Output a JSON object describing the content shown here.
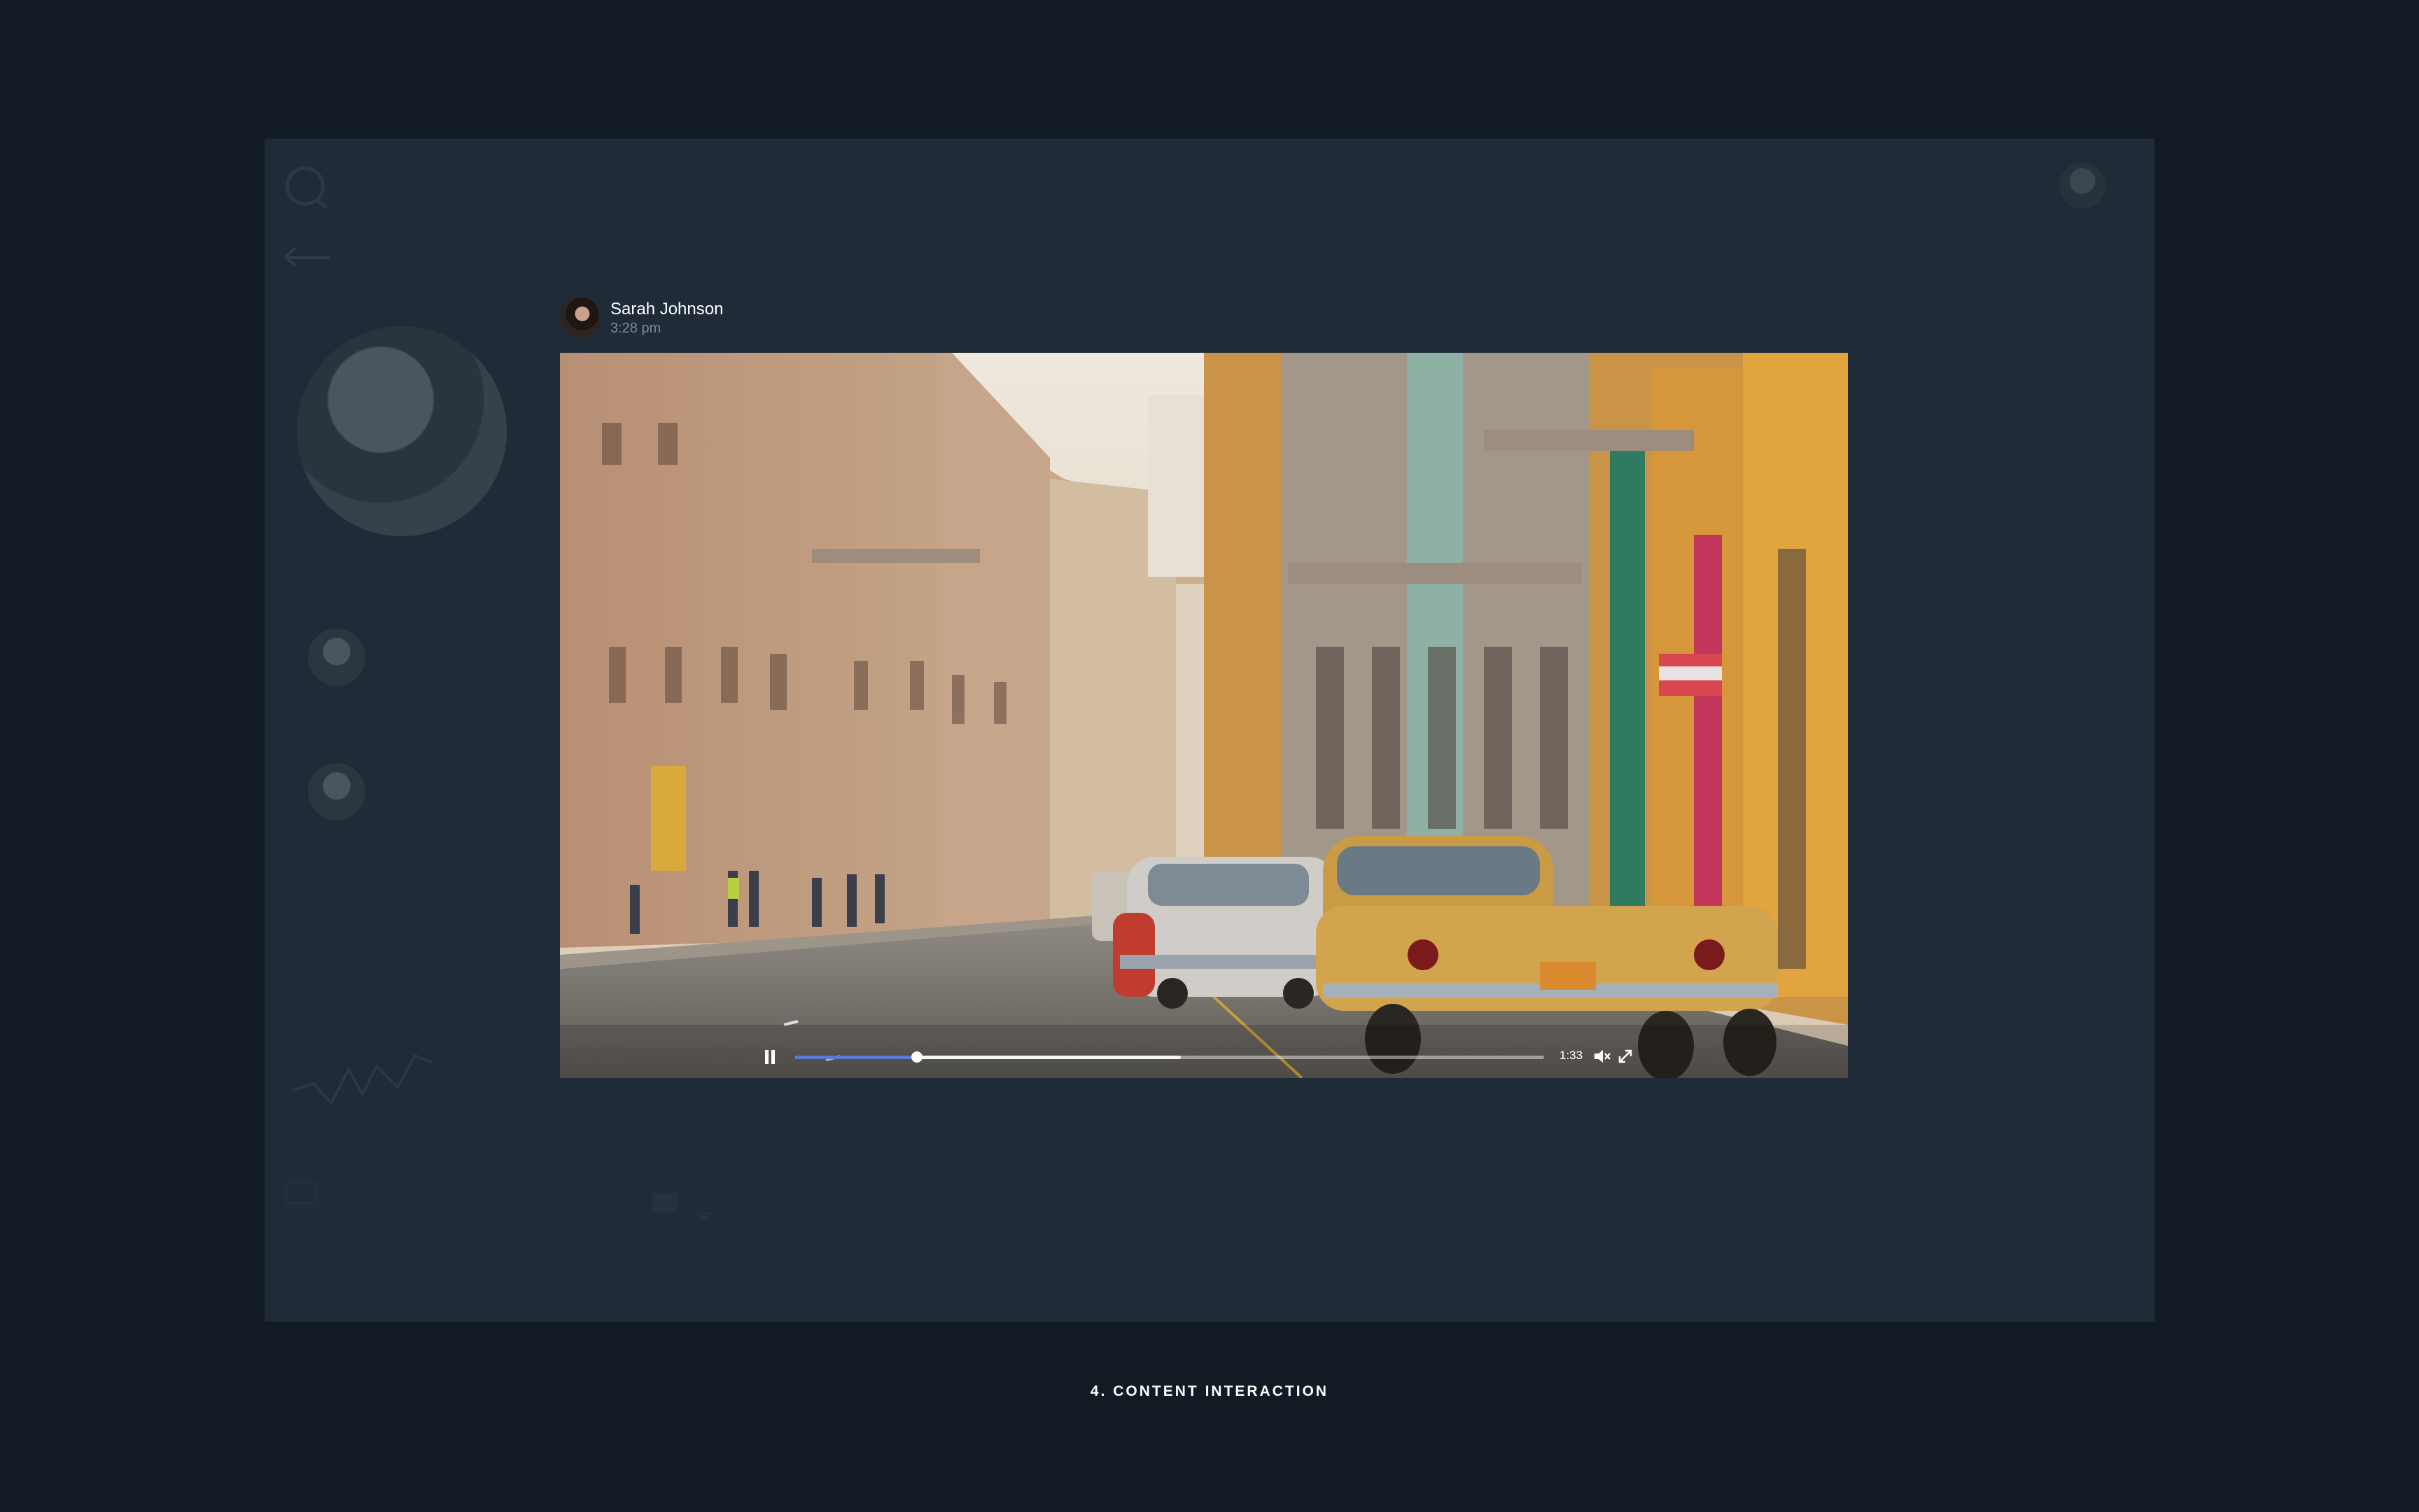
{
  "post": {
    "author_name": "Sarah Johnson",
    "time": "3:28 pm"
  },
  "video": {
    "time_display": "1:33",
    "played_fraction": 0.163,
    "buffered_fraction": 0.515,
    "icons": {
      "play_state": "pause-icon",
      "volume": "volume-icon",
      "fullscreen": "fullscreen-icon"
    }
  },
  "caption": "4. CONTENT INTERACTION",
  "colors": {
    "page_background": "#121b23",
    "app_background": "#1f2b36",
    "progress_accent": "#5a78d6"
  }
}
